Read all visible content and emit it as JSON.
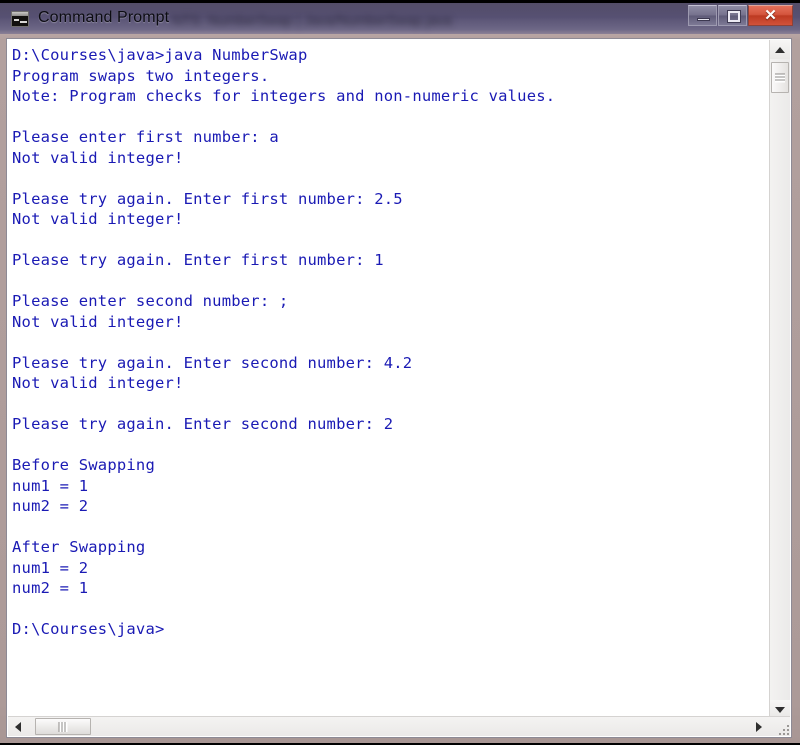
{
  "window": {
    "title": "Command Prompt",
    "title_secondary_blurred": "NTS: NumberSwap | Java/NumberSwap.java",
    "icon": "cmd-console-icon",
    "controls": {
      "minimize_label": "—",
      "maximize_label": "□",
      "close_label": "✕"
    }
  },
  "console": {
    "background_color": "#ffffff",
    "text_color": "#1a1ab4",
    "lines": [
      "D:\\Courses\\java>java NumberSwap",
      "Program swaps two integers.",
      "Note: Program checks for integers and non-numeric values.",
      "",
      "Please enter first number: a",
      "Not valid integer!",
      "",
      "Please try again. Enter first number: 2.5",
      "Not valid integer!",
      "",
      "Please try again. Enter first number: 1",
      "",
      "Please enter second number: ;",
      "Not valid integer!",
      "",
      "Please try again. Enter second number: 4.2",
      "Not valid integer!",
      "",
      "Please try again. Enter second number: 2",
      "",
      "Before Swapping",
      "num1 = 1",
      "num2 = 2",
      "",
      "After Swapping",
      "num1 = 2",
      "num2 = 1",
      "",
      "D:\\Courses\\java>"
    ]
  },
  "scrollbars": {
    "vertical": {
      "up_arrow": "▲",
      "down_arrow": "▼"
    },
    "horizontal": {
      "left_arrow": "◀",
      "right_arrow": "▶"
    }
  }
}
